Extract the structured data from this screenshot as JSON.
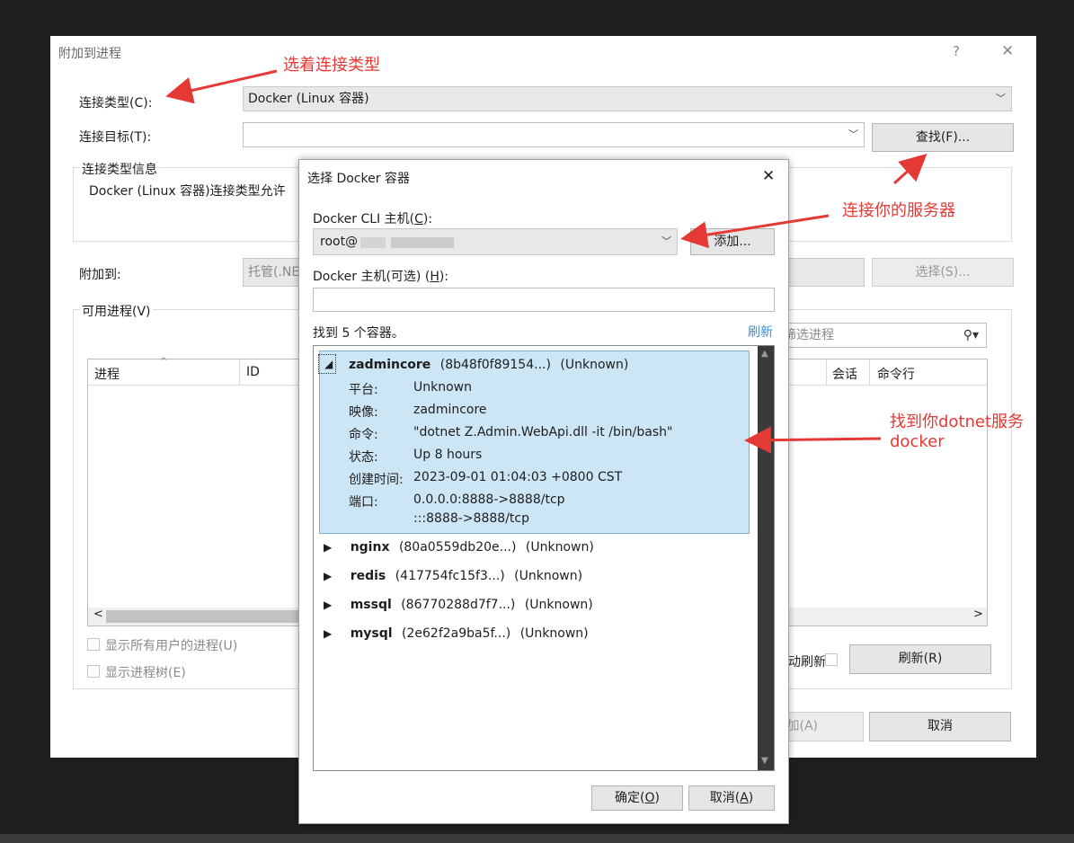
{
  "main_dialog": {
    "title": "附加到进程",
    "help_icon": "?",
    "close_icon": "✕",
    "connection_type_label": "连接类型(C):",
    "connection_type_value": "Docker (Linux 容器)",
    "connection_target_label": "连接目标(T):",
    "connection_target_value": "",
    "find_button": "查找(F)...",
    "connection_info_title": "连接类型信息",
    "connection_info_text": "Docker (Linux 容器)连接类型允许",
    "attach_to_label": "附加到:",
    "attach_to_value": "托管(.NE",
    "select_button": "选择(S)...",
    "available_processes_label": "可用进程(V)",
    "filter_placeholder": "筛选进程",
    "columns": {
      "process": "进程",
      "id": "ID",
      "session": "会话",
      "command_line": "命令行"
    },
    "show_all_users": "显示所有用户的进程(U)",
    "show_process_tree": "显示进程树(E)",
    "auto_refresh_label": "动刷新",
    "refresh_button": "刷新(R)",
    "attach_button": "加(A)",
    "cancel_button": "取消"
  },
  "docker_dialog": {
    "title": "选择 Docker 容器",
    "cli_host_label": "Docker CLI 主机(",
    "cli_host_key": "C",
    "cli_host_label_end": "):",
    "cli_host_value": "root@",
    "add_button": "添加...",
    "host_optional_label": "Docker 主机(可选) (",
    "host_optional_key": "H",
    "host_optional_label_end": "):",
    "host_optional_value": "",
    "found_text": "找到 5 个容器。",
    "refresh_link": "刷新",
    "ok_label": "确定(",
    "ok_key": "O",
    "ok_end": ")",
    "cancel_label": "取消(",
    "cancel_key": "A",
    "cancel_end": ")",
    "selected": {
      "name": "zadmincore",
      "id": "(8b48f0f89154...)",
      "status_tag": "(Unknown)",
      "details": [
        {
          "label": "平台:",
          "value": "Unknown"
        },
        {
          "label": "映像:",
          "value": "zadmincore"
        },
        {
          "label": "命令:",
          "value": "\"dotnet Z.Admin.WebApi.dll -it /bin/bash\""
        },
        {
          "label": "状态:",
          "value": "Up 8 hours"
        },
        {
          "label": "创建时间:",
          "value": "2023-09-01 01:04:03 +0800 CST"
        },
        {
          "label": "端口:",
          "value": "0.0.0.0:8888->8888/tcp"
        }
      ],
      "ports_line2": ":::8888->8888/tcp"
    },
    "containers": [
      {
        "name": "nginx",
        "id": "(80a0559db20e...)",
        "status": "(Unknown)"
      },
      {
        "name": "redis",
        "id": "(417754fc15f3...)",
        "status": "(Unknown)"
      },
      {
        "name": "mssql",
        "id": "(86770288d7f7...)",
        "status": "(Unknown)"
      },
      {
        "name": "mysql",
        "id": "(2e62f2a9ba5f...)",
        "status": "(Unknown)"
      }
    ]
  },
  "annotations": {
    "select_type": "选着连接类型",
    "connect_server": "连接你的服务器",
    "find_service_line1": "找到你dotnet服务",
    "find_service_line2": "docker"
  },
  "colors": {
    "annotation": "#e53935",
    "selection": "#cce6f5",
    "link": "#3a8fd6"
  }
}
